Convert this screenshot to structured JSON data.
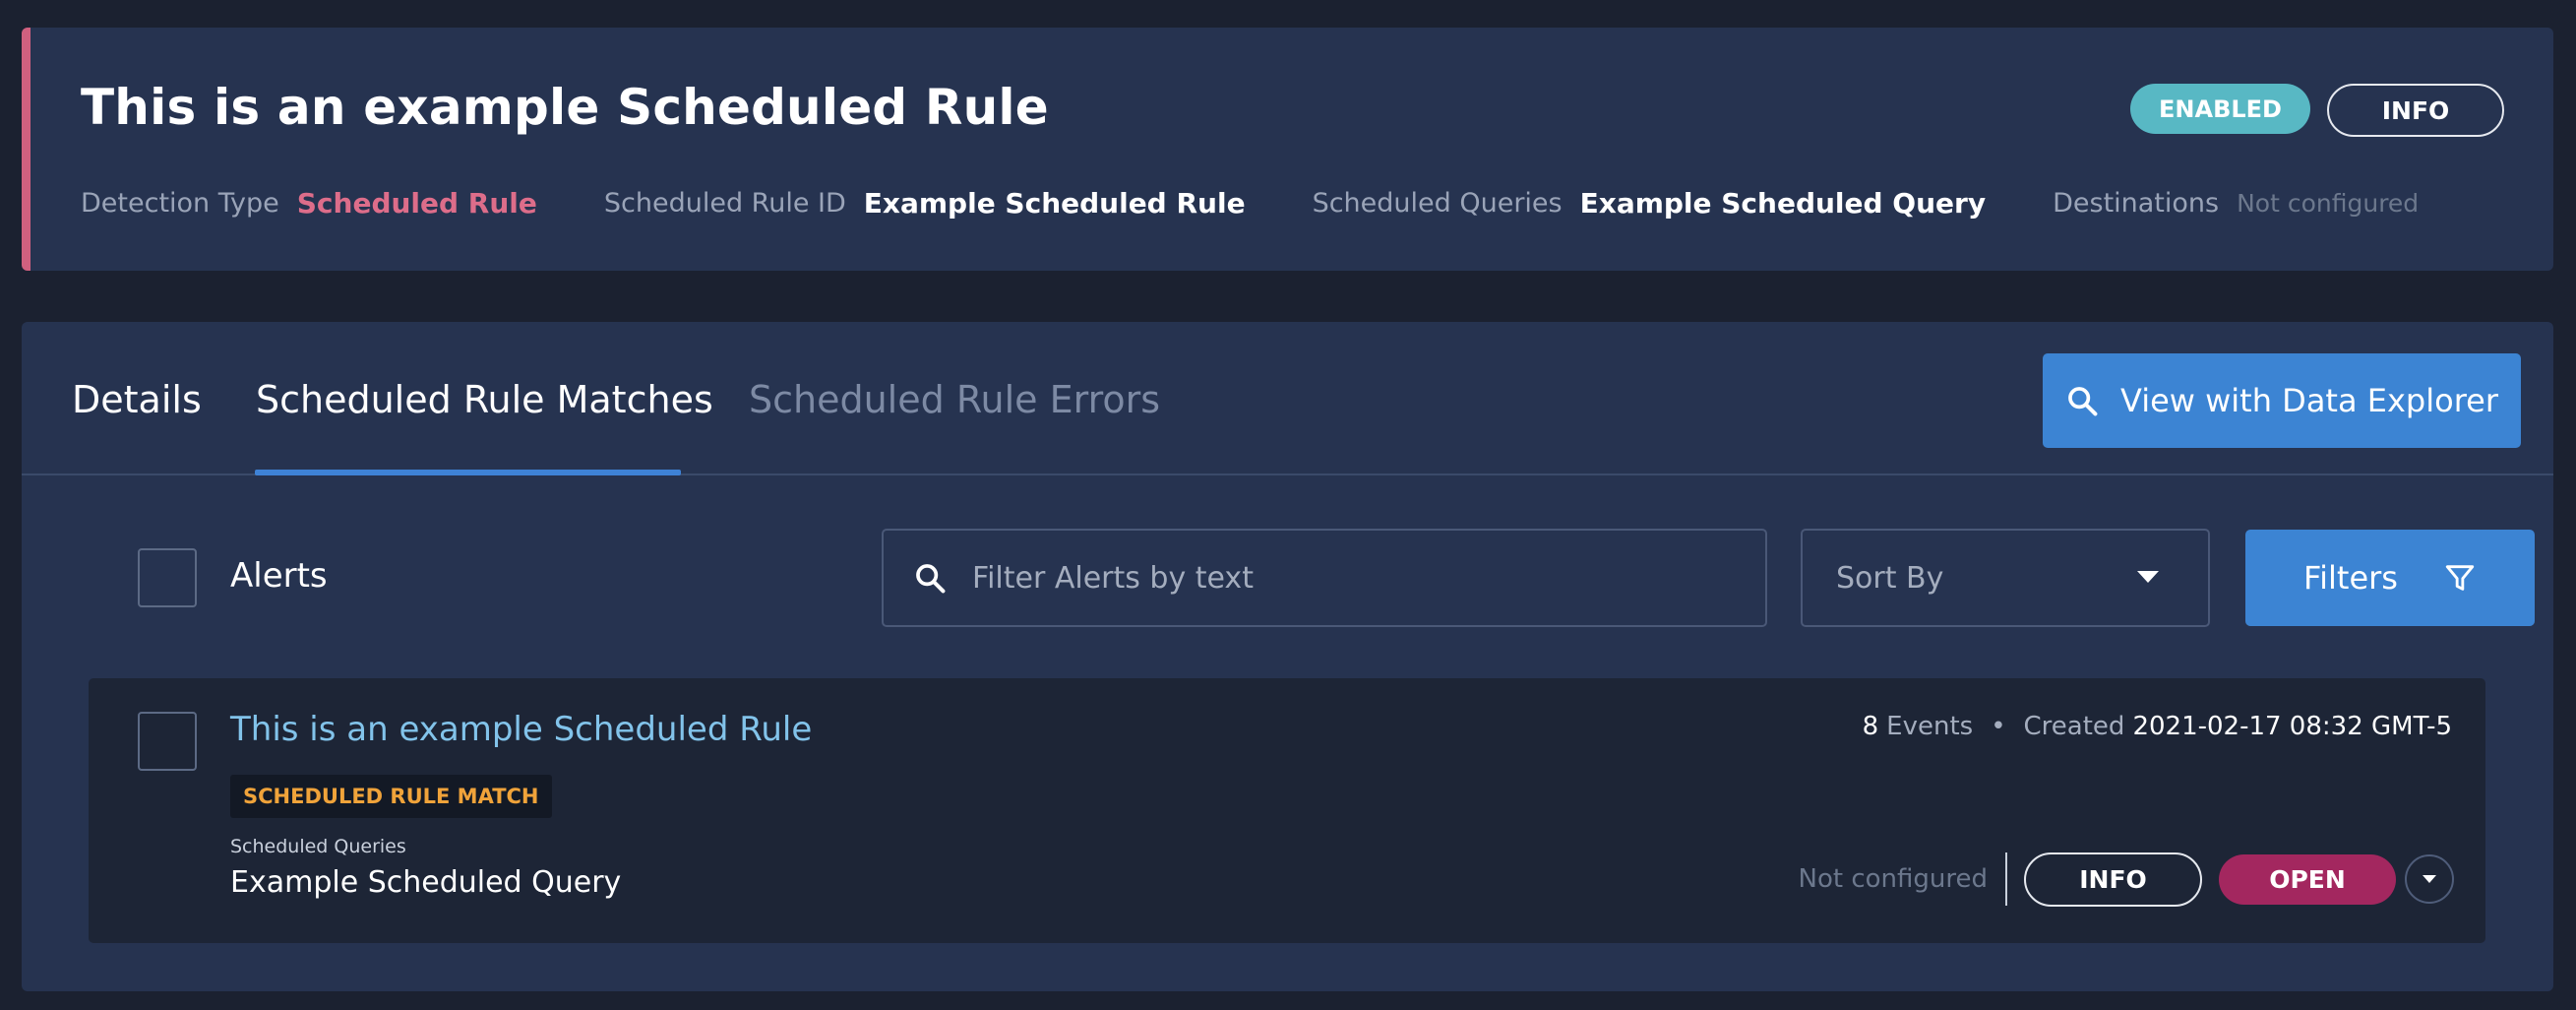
{
  "header": {
    "title": "This is an example Scheduled Rule",
    "enabled_badge": "ENABLED",
    "severity_badge": "INFO",
    "accent_color": "#d0607f",
    "meta": [
      {
        "label": "Detection Type",
        "value": "Scheduled Rule"
      },
      {
        "label": "Scheduled Rule ID",
        "value": "Example Scheduled Rule"
      },
      {
        "label": "Scheduled Queries",
        "value": "Example Scheduled Query"
      },
      {
        "label": "Destinations",
        "value": "Not configured"
      }
    ]
  },
  "tabs": [
    {
      "label": "Details",
      "active": false
    },
    {
      "label": "Scheduled Rule Matches",
      "active": true
    },
    {
      "label": "Scheduled Rule Errors",
      "active": false,
      "disabled": true
    }
  ],
  "explorer_button": {
    "label": "View with Data Explorer",
    "icon": "search-icon"
  },
  "toolbar": {
    "select_all_label": "Alerts",
    "search_placeholder": "Filter Alerts by text",
    "sort_placeholder": "Sort By",
    "filters_label": "Filters",
    "filters_icon": "filter-icon"
  },
  "alerts": [
    {
      "title": "This is an example Scheduled Rule",
      "type_badge": "SCHEDULED RULE MATCH",
      "queries_label": "Scheduled Queries",
      "queries_value": "Example Scheduled Query",
      "event_count": "8",
      "events_label": "Events",
      "separator": "•",
      "created_label": "Created",
      "created_at": "2021-02-17 08:32 GMT-5",
      "destinations_status": "Not configured",
      "severity": "INFO",
      "status": "OPEN"
    }
  ],
  "colors": {
    "background": "#1b2130",
    "card": "#263350",
    "primary": "#3c84d3",
    "enabled": "#58b8c4",
    "open": "#a3275f",
    "link": "#82c3ea",
    "badge_text": "#f0a33a"
  }
}
